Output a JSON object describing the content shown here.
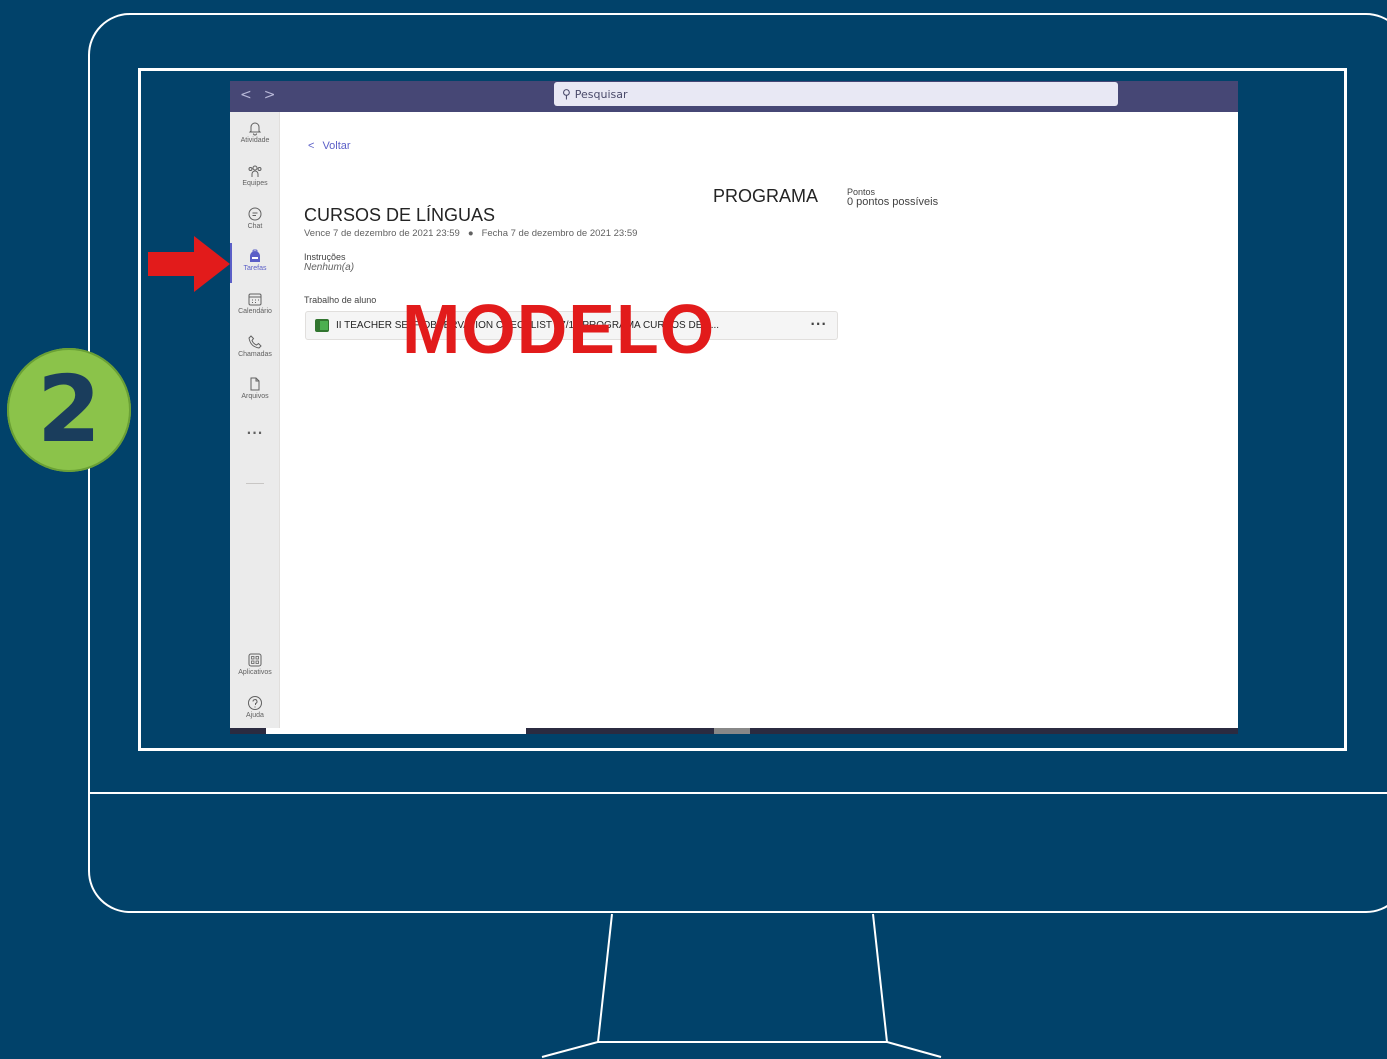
{
  "step_number": "2",
  "colors": {
    "background": "#01426a",
    "badge": "#8bc34a",
    "arrow": "#e21b1b",
    "teams_topbar": "#464775",
    "accent": "#5b5fc7",
    "watermark": "#e21b1b"
  },
  "topbar": {
    "nav_icons": [
      "chevron-left-icon",
      "chevron-right-icon"
    ],
    "search_placeholder": "Pesquisar"
  },
  "rail": {
    "items": [
      {
        "label": "Atividade",
        "icon": "bell-icon"
      },
      {
        "label": "Equipes",
        "icon": "people-icon"
      },
      {
        "label": "Chat",
        "icon": "chat-icon"
      },
      {
        "label": "Tarefas",
        "icon": "backpack-icon",
        "active": true
      },
      {
        "label": "Calendário",
        "icon": "calendar-icon"
      },
      {
        "label": "Chamadas",
        "icon": "phone-icon"
      },
      {
        "label": "Arquivos",
        "icon": "file-icon"
      },
      {
        "label": "...",
        "icon": "more-icon"
      }
    ],
    "bottom_items": [
      {
        "label": "Aplicativos",
        "icon": "apps-icon"
      },
      {
        "label": "Ajuda",
        "icon": "help-icon"
      }
    ]
  },
  "assignment": {
    "back_label": "Voltar",
    "category": "PROGRAMA",
    "points_label": "Pontos",
    "points_value": "0 pontos possíveis",
    "title": "CURSOS DE LÍNGUAS",
    "due": "Vence 7 de dezembro de 2021 23:59",
    "close": "Fecha 7 de dezembro de 2021 23:59",
    "instructions_label": "Instruções",
    "instructions_value": "Nenhum(a)",
    "student_work_label": "Trabalho de aluno",
    "file_name": "II TEACHER SELF OBSERVATION CHECKLIST 07/12 PROGRAMA CURSOS DE L...",
    "more_label": "···"
  },
  "watermark": "MODELO"
}
